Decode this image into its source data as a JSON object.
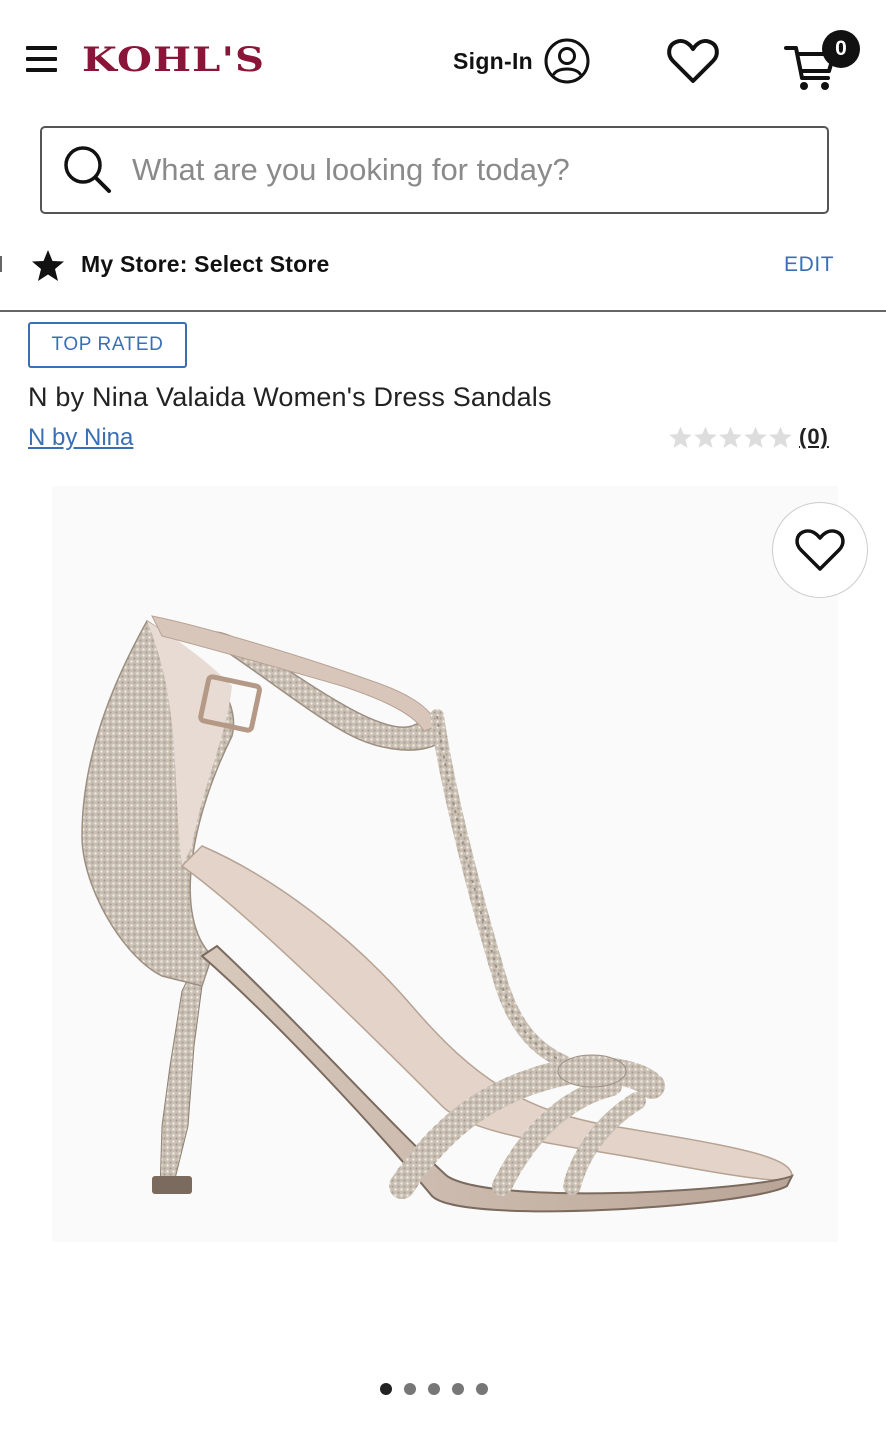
{
  "header": {
    "logo_text": "KOHL'S",
    "signin_label": "Sign-In",
    "cart_count": "0"
  },
  "search": {
    "placeholder": "What are you looking for today?"
  },
  "store": {
    "label": "My Store: Select Store",
    "edit_label": "EDIT"
  },
  "product": {
    "badge": "TOP RATED",
    "title": "N by Nina Valaida Women's Dress Sandals",
    "brand": "N by Nina",
    "rating_value": 0,
    "rating_max": 5,
    "review_count": "(0)",
    "image_count": 5,
    "active_image_index": 0
  },
  "colors": {
    "brand": "#8a1538",
    "link": "#3a6fb5",
    "text": "#222222",
    "star_empty": "#dddddd"
  },
  "icons": {
    "menu": "hamburger-menu-icon",
    "account": "user-circle-icon",
    "wishlist": "heart-icon",
    "cart": "shopping-cart-icon",
    "search": "search-icon",
    "store": "star-icon"
  }
}
